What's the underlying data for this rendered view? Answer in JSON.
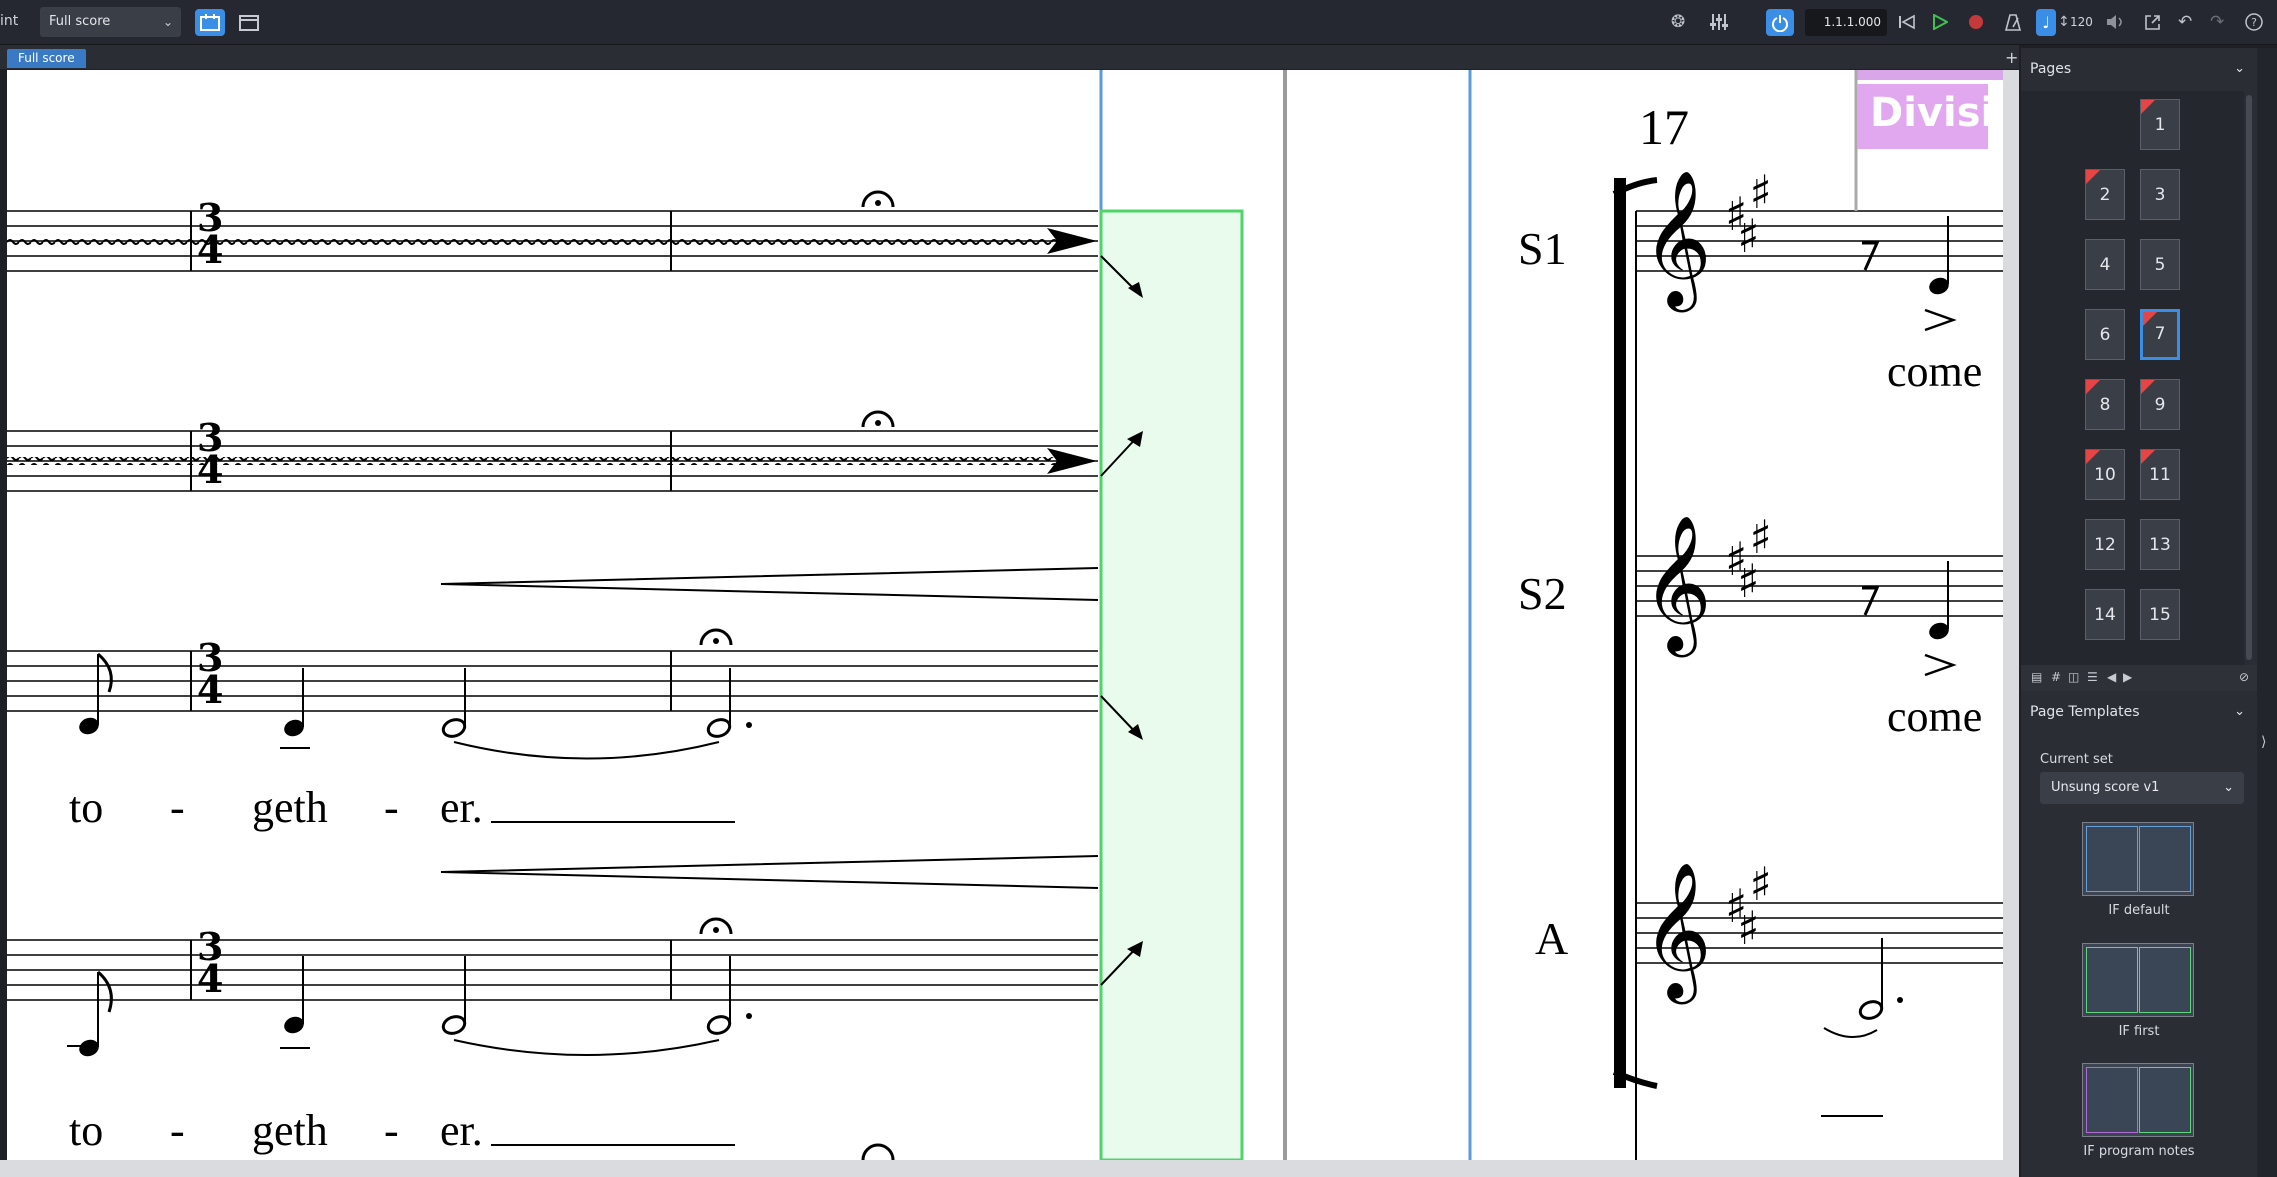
{
  "toolbar": {
    "mode_label": "int",
    "layout_select": "Full score",
    "position": "1.1.1.000",
    "tempo": "120"
  },
  "tabs": [
    {
      "label": "Full score"
    }
  ],
  "pages_panel": {
    "title": "Pages",
    "pages": [
      {
        "label": "1",
        "flag": true
      },
      {
        "label": "2",
        "flag": true
      },
      {
        "label": "3",
        "flag": false
      },
      {
        "label": "4",
        "flag": false
      },
      {
        "label": "5",
        "flag": false
      },
      {
        "label": "6",
        "flag": false
      },
      {
        "label": "7",
        "flag": true,
        "selected": true
      },
      {
        "label": "8",
        "flag": true
      },
      {
        "label": "9",
        "flag": true
      },
      {
        "label": "10",
        "flag": true
      },
      {
        "label": "11",
        "flag": true
      },
      {
        "label": "12",
        "flag": false
      },
      {
        "label": "13",
        "flag": false
      },
      {
        "label": "14",
        "flag": false
      },
      {
        "label": "15",
        "flag": false
      }
    ]
  },
  "templates_panel": {
    "title": "Page Templates",
    "current_set_label": "Current set",
    "current_set": "Unsung score v1",
    "templates": [
      {
        "name": "IF default"
      },
      {
        "name": "IF first"
      },
      {
        "name": "IF program notes"
      }
    ]
  },
  "score": {
    "measure_number": "17",
    "divisi_label": "Divisi",
    "staff_labels": [
      "S1",
      "S2",
      "A"
    ],
    "lyric_lines": [
      [
        "to",
        "-",
        "geth",
        "-",
        "er."
      ],
      [
        "to",
        "-",
        "geth",
        "-",
        "er."
      ]
    ],
    "right_lyrics": [
      "come",
      "come"
    ],
    "time_signature": {
      "top": "3",
      "bottom": "4"
    }
  }
}
